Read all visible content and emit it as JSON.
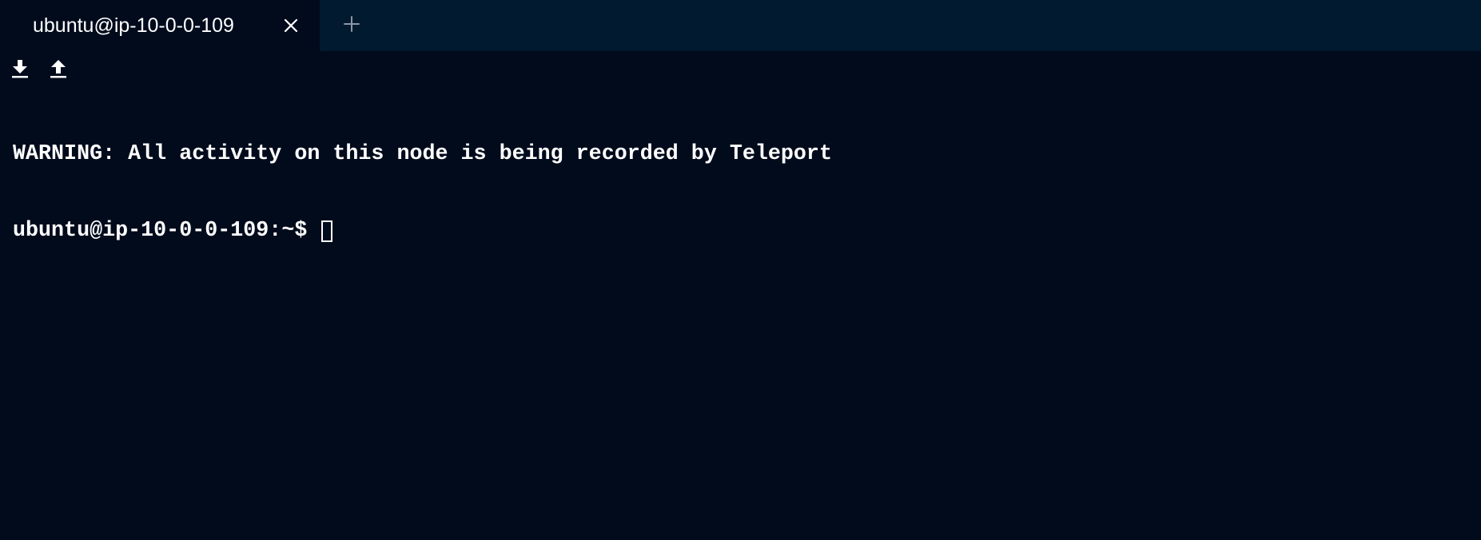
{
  "tabs": [
    {
      "title": "ubuntu@ip-10-0-0-109",
      "close_icon": "close-icon"
    }
  ],
  "new_tab_icon": "plus-icon",
  "toolbar": {
    "download_icon": "download-icon",
    "upload_icon": "upload-icon"
  },
  "terminal": {
    "lines": [
      "WARNING: All activity on this node is being recorded by Teleport",
      "ubuntu@ip-10-0-0-109:~$ "
    ]
  },
  "colors": {
    "terminal_background": "#010b1c",
    "tabbar_background": "#011a30",
    "text": "#ffffff",
    "icon_muted": "#8a96a8"
  }
}
